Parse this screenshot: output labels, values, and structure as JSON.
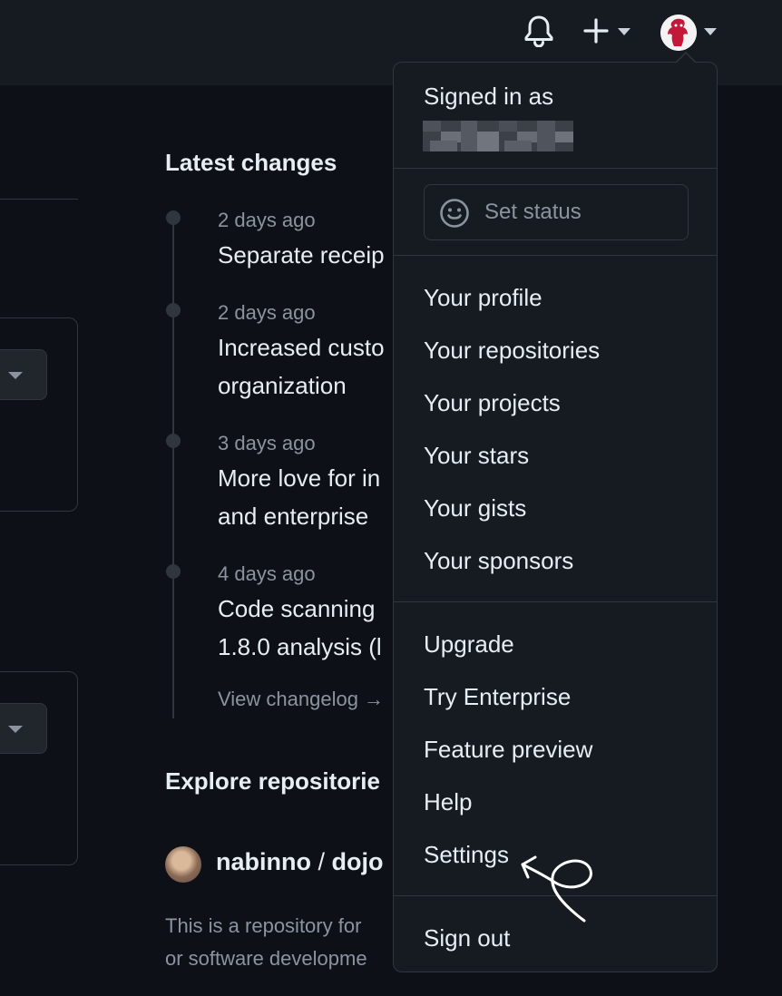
{
  "header": {
    "icons": [
      "bell-icon",
      "plus-icon",
      "avatar"
    ]
  },
  "latest_changes": {
    "title": "Latest changes",
    "items": [
      {
        "date": "2 days ago",
        "title_lines": [
          "Separate receip"
        ]
      },
      {
        "date": "2 days ago",
        "title_lines": [
          "Increased custo",
          "organization"
        ]
      },
      {
        "date": "3 days ago",
        "title_lines": [
          "More love for in",
          "and enterprise"
        ]
      },
      {
        "date": "4 days ago",
        "title_lines": [
          "Code scanning",
          "1.8.0 analysis (l"
        ]
      }
    ],
    "changelog_link": "View changelog →"
  },
  "explore": {
    "title": "Explore repositorie",
    "repo_owner": "nabinno",
    "repo_sep": " / ",
    "repo_name": "dojo",
    "desc_lines": [
      "This is a repository for",
      "or software developme"
    ]
  },
  "dropdown": {
    "signed_in_label": "Signed in as",
    "set_status": "Set status",
    "group1": [
      "Your profile",
      "Your repositories",
      "Your projects",
      "Your stars",
      "Your gists",
      "Your sponsors"
    ],
    "group2": [
      "Upgrade",
      "Try Enterprise",
      "Feature preview",
      "Help",
      "Settings"
    ],
    "sign_out": "Sign out"
  },
  "colors": {
    "page_bg": "#0d1117",
    "header_bg": "#161b22",
    "menu_bg": "#161b22",
    "border": "#30363d",
    "text": "#e6edf3",
    "muted": "#8b949e"
  }
}
